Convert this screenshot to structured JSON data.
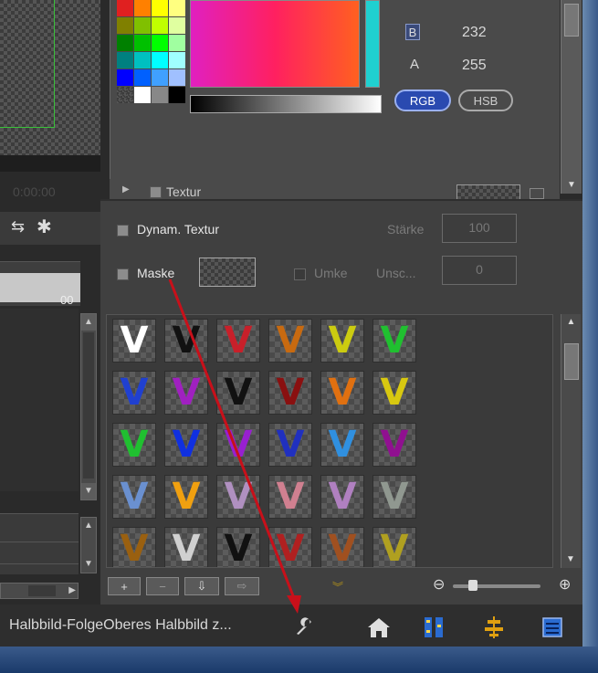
{
  "color_panel": {
    "b_label": "B",
    "b_value": "232",
    "a_label": "A",
    "a_value": "255",
    "rgb_button": "RGB",
    "hsb_button": "HSB",
    "textur_label": "Textur"
  },
  "timeline": {
    "timecode": "0:00:00",
    "ruler_label": "00"
  },
  "texture_panel": {
    "dynam_textur_label": "Dynam. Textur",
    "staerke_label": "Stärke",
    "staerke_value": "100",
    "maske_label": "Maske",
    "umkehren_label": "Umke",
    "unschaerfe_label": "Unsc...",
    "unschaerfe_value": "0"
  },
  "swatch_grid": {
    "glyph": "V",
    "colors": [
      [
        "#ffffff",
        "#111111",
        "#c8202a",
        "#c86a10",
        "#cccc10",
        "#20c030"
      ],
      [
        "#2040d0",
        "#a020c0",
        "#111111",
        "#8a1010",
        "#e07010",
        "#d8c810"
      ],
      [
        "#20c030",
        "#1030e0",
        "#9820d0",
        "#2030c0",
        "#3090e0",
        "#901090"
      ],
      [
        "#6a90d0",
        "#f0a010",
        "#b090c0",
        "#d08090",
        "#b080c0",
        "#909890"
      ],
      [
        "#9a6010",
        "#d0d0d0",
        "#111111",
        "#b02020",
        "#a05020",
        "#b0a020"
      ]
    ]
  },
  "toolbar": {
    "add_button": "+",
    "remove_button": "−",
    "import_button": "⇩",
    "export_button": "⇨",
    "zoom_out": "⊖",
    "zoom_in": "⊕",
    "zoom_level": 0.2
  },
  "status": {
    "text": "Halbbild-FolgeOberes Halbbild z..."
  },
  "icons": {
    "wrench": "wrench-icon",
    "home": "home-icon",
    "columns": "columns-icon",
    "align": "align-icon",
    "stack": "stack-icon"
  },
  "colors": {
    "accent_blue": "#2a6bd0",
    "annotation_red": "#c8101a"
  }
}
